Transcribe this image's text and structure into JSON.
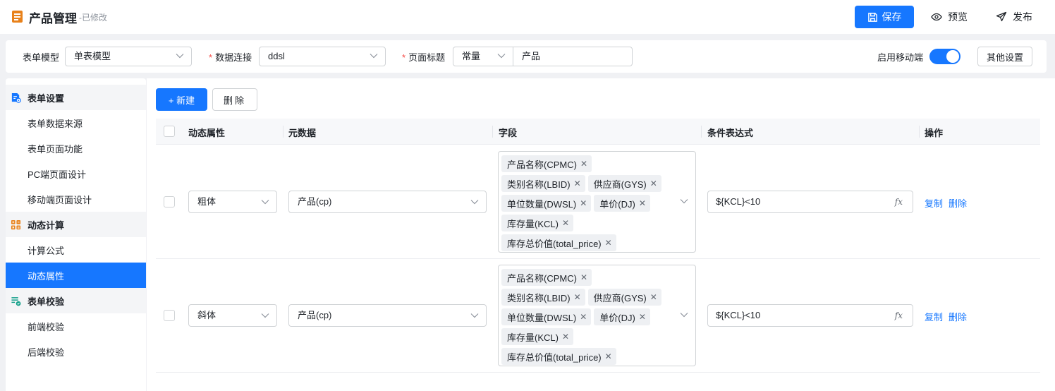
{
  "header": {
    "title": "产品管理",
    "state": "-已修改",
    "save_label": "保存",
    "preview_label": "预览",
    "publish_label": "发布"
  },
  "settings": {
    "form_model_label": "表单模型",
    "form_model_value": "单表模型",
    "data_conn_label": "数据连接",
    "data_conn_value": "ddsl",
    "page_title_label": "页面标题",
    "page_title_type": "常量",
    "page_title_value": "产品",
    "mobile_label": "启用移动端",
    "mobile_enabled": true,
    "other_settings_label": "其他设置"
  },
  "nav": {
    "groups": [
      {
        "label": "表单设置",
        "icon": "form-settings-icon",
        "items": [
          "表单数据来源",
          "表单页面功能",
          "PC端页面设计",
          "移动端页面设计"
        ]
      },
      {
        "label": "动态计算",
        "icon": "calculator-icon",
        "items": [
          "计算公式",
          "动态属性"
        ]
      },
      {
        "label": "表单校验",
        "icon": "check-list-icon",
        "items": [
          "前端校验",
          "后端校验"
        ]
      }
    ],
    "active": "动态属性"
  },
  "toolbar": {
    "new_label": "+ 新建",
    "delete_label": "删除"
  },
  "table": {
    "columns": [
      "动态属性",
      "元数据",
      "字段",
      "条件表达式",
      "操作"
    ],
    "rows": [
      {
        "attr": "粗体",
        "meta": "产品(cp)",
        "fields": [
          "产品名称(CPMC)",
          "类别名称(LBID)",
          "供应商(GYS)",
          "单位数量(DWSL)",
          "单价(DJ)",
          "库存量(KCL)",
          "库存总价值(total_price)"
        ],
        "expr": "${KCL}<10",
        "copy": "复制",
        "delete": "删除"
      },
      {
        "attr": "斜体",
        "meta": "产品(cp)",
        "fields": [
          "产品名称(CPMC)",
          "类别名称(LBID)",
          "供应商(GYS)",
          "单位数量(DWSL)",
          "单价(DJ)",
          "库存量(KCL)",
          "库存总价值(total_price)"
        ],
        "expr": "${KCL}<10",
        "copy": "复制",
        "delete": "删除"
      }
    ]
  },
  "colors": {
    "primary": "#1677ff",
    "brand_icon": "#e8811a",
    "danger": "#f54a45"
  }
}
